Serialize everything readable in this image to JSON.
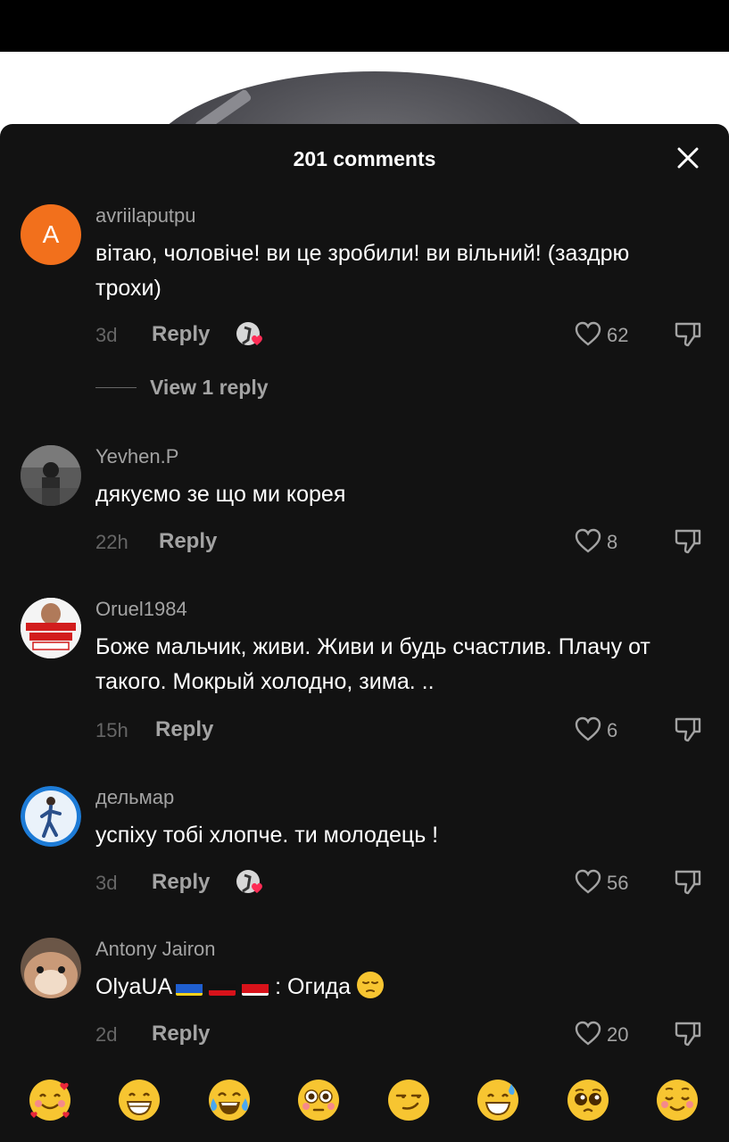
{
  "sheet": {
    "title": "201 comments"
  },
  "comments": [
    {
      "avatar_letter": "A",
      "username": "avriilaputpu",
      "text": "вітаю, чоловіче! ви це зробили! ви вільний! (заздрю трохи)",
      "time": "3d",
      "reply_label": "Reply",
      "likes": "62",
      "view_replies": "View 1 reply"
    },
    {
      "username": "Yevhen.P",
      "text": "дякуємо зе що ми корея",
      "time": "22h",
      "reply_label": "Reply",
      "likes": "8"
    },
    {
      "username": "Oruel1984",
      "avatar_text": "АНДРЕЙ ОРУЕЛ 1984",
      "text": "Боже мальчик, живи. Живи и будь счастлив. Плачу от такого. Мокрый холодно, зима. ..",
      "time": "15h",
      "reply_label": "Reply",
      "likes": "6"
    },
    {
      "username": "дельмар",
      "text": "успіху тобі хлопче. ти молодець !",
      "time": "3d",
      "reply_label": "Reply",
      "likes": "56"
    },
    {
      "username": "Antony Jairon",
      "text_prefix": "OlyaUA",
      "text_suffix": ": Огида",
      "time": "2d",
      "reply_label": "Reply",
      "likes": "20"
    }
  ],
  "emoji_bar": [
    "smiling-face-with-hearts",
    "grinning-face",
    "face-with-tears-of-joy",
    "flushed-face",
    "smirking-face",
    "grinning-face-with-sweat",
    "pleading-face",
    "relieved-face"
  ],
  "colors": {
    "sheet_bg": "#121212",
    "avatar_orange": "#f2701c",
    "heart_red": "#fe2c55",
    "muted_text": "#a3a3a3"
  }
}
